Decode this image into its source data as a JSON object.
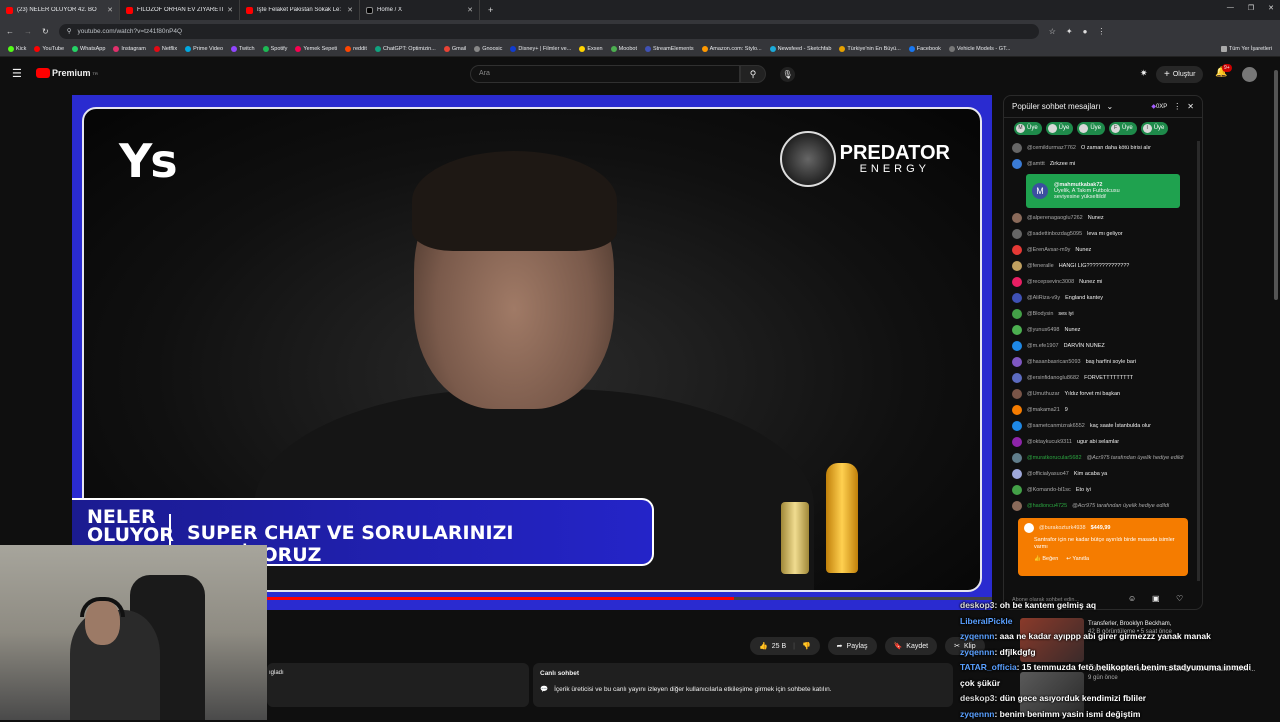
{
  "browser": {
    "tabs": [
      {
        "label": "(23) NELER OLUYOR 42. BÖ",
        "active": true,
        "icon": "youtube-icon"
      },
      {
        "label": "FİLOZOF ORHAN EV ZİYARETİ -",
        "active": false,
        "icon": "youtube-icon"
      },
      {
        "label": "İşte Felaket Pakistan Sokak Le:",
        "active": false,
        "icon": "youtube-icon"
      },
      {
        "label": "Home / X",
        "active": false,
        "icon": "x-icon"
      }
    ],
    "url": "youtube.com/watch?v=tz41f80nP4Q",
    "bookmarks": [
      "Kick",
      "YouTube",
      "WhatsApp",
      "Instagram",
      "Netflix",
      "Prime Video",
      "Twitch",
      "Spotify",
      "Yemek Sepeti",
      "reddit",
      "ChatGPT: Optimizin...",
      "Gmail",
      "Gnoosic",
      "Disney+ | Filmler ve...",
      "Exxen",
      "Moobot",
      "StreamElements",
      "Amazon.com: Stylo...",
      "Newsfeed - Sketchfab",
      "Türkiye'nin En Büyü...",
      "Facebook",
      "Vehicle Models - GT..."
    ],
    "all_bookmarks": "Tüm Yer İşaretleri"
  },
  "youtube": {
    "logo": "Premium",
    "logo_sup": "TR",
    "search_placeholder": "Ara",
    "create_label": "Oluştur",
    "notif_count": "9+"
  },
  "video": {
    "logo_left": "Ys",
    "sponsor_line1": "PREDATOR",
    "sponsor_line2": "ENERGY",
    "banner_brand": "NELER OLUYOR",
    "banner_text": "SUPER CHAT VE SORULARINIZI BEKLİYORUZ",
    "progress": 0.72
  },
  "actions": {
    "like_count": "25 B",
    "share": "Paylaş",
    "save": "Kaydet",
    "clip": "Klip"
  },
  "live_chat_box": {
    "title": "Canlı sohbet",
    "text": "İçerik üreticisi ve bu canlı yayını izleyen diğer kullanıcılarla etkileşime girmek için sohbete katılın.",
    "desc_fragment": "ıgladı"
  },
  "chat": {
    "title": "Popüler sohbet mesajları",
    "points": "0XP",
    "badge_label": "Üye",
    "badges": [
      "M",
      "",
      "",
      "F",
      "I"
    ],
    "member_card": {
      "user": "@mahmutkabak72",
      "line1": "Üyelik, A Takım Futbolcusu",
      "line2": "seviyesine yükseltildi!",
      "avatar": "M"
    },
    "messages_top": [
      {
        "user": "@cemildurmaz7762",
        "text": "O zaman daha kötü birisi alır",
        "color": "#666"
      },
      {
        "user": "@amttt",
        "text": "Zirkzee mi",
        "color": "#3a7bd5"
      }
    ],
    "messages": [
      {
        "user": "@alperenagaoglu7262",
        "text": "Nunez",
        "color": "#8a6a5a"
      },
      {
        "user": "@sadettinbozdag5095",
        "text": "leva mı geliyor",
        "color": "#666"
      },
      {
        "user": "@ErenAvsar-m9y",
        "text": "Nunez",
        "color": "#e53935"
      },
      {
        "user": "@feneralle",
        "text": "HANGI LIG??????????????",
        "color": "#c0a060"
      },
      {
        "user": "@recepsevinc3008",
        "text": "Nunez mi",
        "color": "#e91e63"
      },
      {
        "user": "@AliRiza-v9y",
        "text": "England kantey",
        "color": "#3f51b5"
      },
      {
        "user": "@Blodysin",
        "text": "ses iyi",
        "color": "#43a047"
      },
      {
        "user": "@yunus6498",
        "text": "Nunez",
        "color": "#4caf50"
      },
      {
        "user": "@m.efe1907",
        "text": "DARVİN NUNEZ",
        "color": "#1e88e5"
      },
      {
        "user": "@hasanbasrican5093",
        "text": "baş harfini soyle bari",
        "color": "#7e57c2"
      },
      {
        "user": "@ersinfidanoglu8682",
        "text": "FORVETTTTTTTTT",
        "color": "#5c6bc0"
      },
      {
        "user": "@Umuthuzar",
        "text": "Yıldız forvet mi başkan",
        "color": "#795548"
      },
      {
        "user": "@makama21",
        "text": "9",
        "color": "#f57c00"
      },
      {
        "user": "@sametcanmizrak6552",
        "text": "kaç saate İstanbulda olur",
        "color": "#1e88e5"
      },
      {
        "user": "@oktaykucuk9311",
        "text": "ugur abi selamlar",
        "color": "#8e24aa"
      },
      {
        "user": "@muratkorucular5682",
        "text": "@Acr975 tarafından üyelik hediye edildi",
        "color": "#607d8b",
        "green": true
      },
      {
        "user": "@officialyasuo47",
        "text": "Kim acaba ya",
        "color": "#9fa8da"
      },
      {
        "user": "@Komando-bl1sc",
        "text": "Eto iyi",
        "color": "#43a047"
      },
      {
        "user": "@hadioncu4725",
        "text": "@Acr975 tarafından üyelik hediye edildi",
        "color": "#8a6a5a",
        "green": true
      }
    ],
    "superchat": {
      "user": "@burakozturk4938",
      "amount": "$449,99",
      "text": "Santrafor için ne kadar bütçe ayırıldı birde masada isimler varmı",
      "btn1": "Beğen",
      "btn2": "Yanıtla"
    },
    "input_placeholder": "Abone olarak sohbet edin..."
  },
  "overlay_chat": [
    {
      "user": "deskop3",
      "text": ": oh be kantem gelmiş aq",
      "blue": false
    },
    {
      "user": "LiberalPickle",
      "text": "",
      "blue": true
    },
    {
      "user": "zyqennn",
      "text": ": aaa ne kadar ayıppp abi girer girmezzz yanak manak",
      "blue": true
    },
    {
      "user": "zyqennn",
      "text": ": dfjlkdgfg",
      "blue": true
    },
    {
      "user": "TATAR_officia",
      "text": ": 15 temmuzda fetö helikopteri benim stadyumuma inmedi",
      "blue": true
    },
    {
      "user": "",
      "text": "çok şükür",
      "blue": false
    },
    {
      "user": "deskop3",
      "text": ": dün gece asıyorduk kendimizi fbliler",
      "blue": false
    },
    {
      "user": "zyqennn",
      "text": ": benim benimm yasin ismi değiştim",
      "blue": true
    }
  ],
  "recommended": {
    "title": "Transferler, Brooklyn Beckham,",
    "meta": "42 B görüntüleme • 5 saat önce",
    "title2": "TÜM DÜNYANIN HAKKINI YEDİĞİ OYUNU ÖVELİM! TÜRK ...",
    "meta2": "9 gün önce"
  }
}
